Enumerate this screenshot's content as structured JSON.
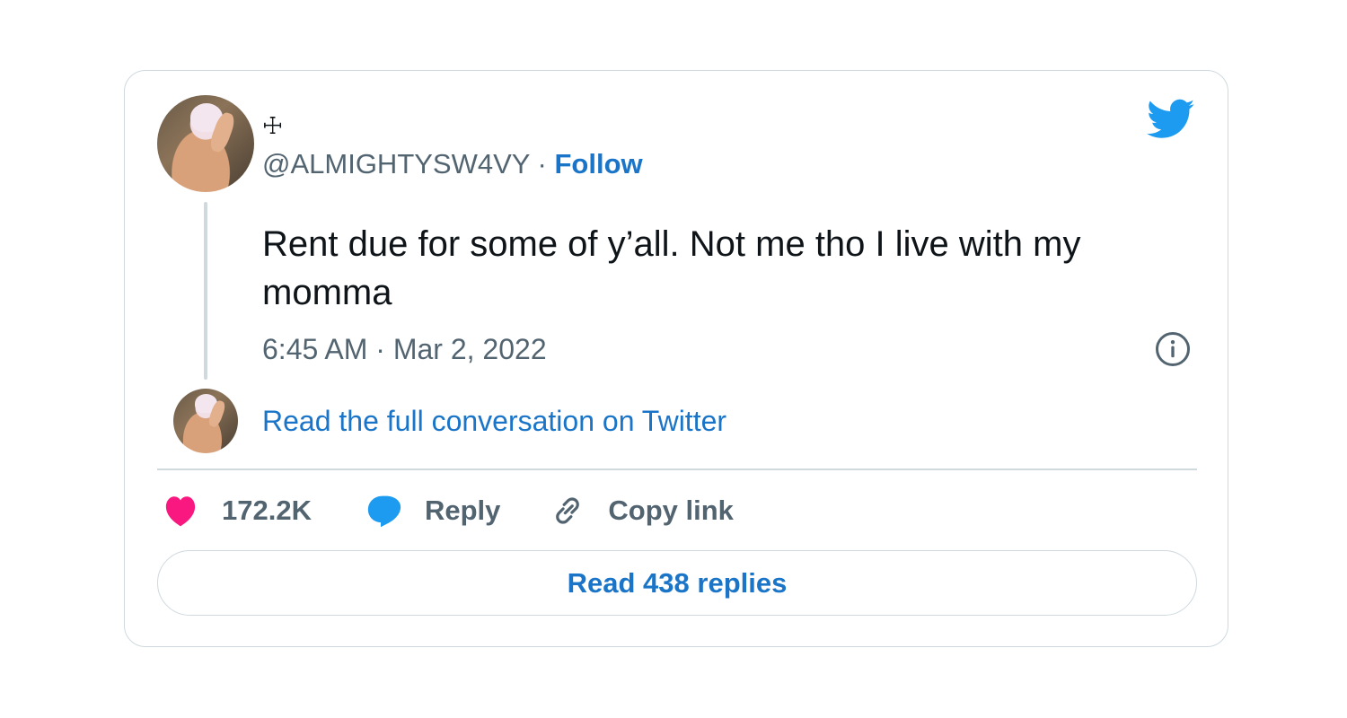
{
  "tweet": {
    "display_name": "☩",
    "handle": "@ALMIGHTYSW4VY",
    "separator": " · ",
    "follow_label": "Follow",
    "text": "Rent due for some of y’all. Not me tho I live with my momma",
    "timestamp": "6:45 AM · Mar 2, 2022",
    "read_full_label": "Read the full conversation on Twitter",
    "likes": "172.2K",
    "reply_label": "Reply",
    "copy_link_label": "Copy link",
    "read_replies_label": "Read 438 replies"
  },
  "icons": {
    "logo": "twitter-bird-icon",
    "info": "info-icon",
    "like": "heart-icon",
    "reply": "speech-bubble-icon",
    "copy": "link-icon"
  },
  "colors": {
    "link_blue": "#1a75c9",
    "twitter_blue": "#1d9bf0",
    "like_pink": "#f91880",
    "secondary_text": "#536471",
    "border": "#cfd9de"
  }
}
